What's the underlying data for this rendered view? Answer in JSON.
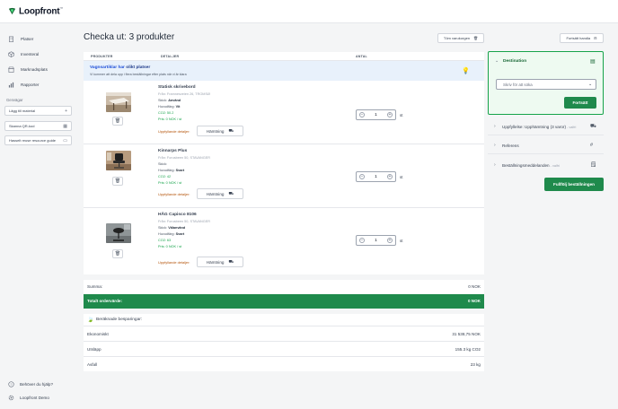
{
  "app": {
    "name": "Loopfront",
    "tm": "™"
  },
  "sidebar": {
    "items": [
      {
        "label": "Platser",
        "icon": "building-icon"
      },
      {
        "label": "Inventeral",
        "icon": "inventory-icon"
      },
      {
        "label": "Marknadsplats",
        "icon": "store-icon"
      },
      {
        "label": "Rapporter",
        "icon": "report-icon"
      }
    ],
    "section": "Genvägar",
    "shortcuts": [
      {
        "label": "Lägg till material",
        "glyph": "+"
      },
      {
        "label": "Skanna QR-kod",
        "glyph": "▦"
      },
      {
        "label": "Hasselt reuse resource guide",
        "glyph": "▭"
      }
    ],
    "help": "Behöver du hjälp?",
    "account": "Loopfront Demo"
  },
  "header": {
    "title": "Checka ut: 3 produkter",
    "clear_cart": "Töm varukorgen",
    "continue_shopping": "Fortsätt handla"
  },
  "cart": {
    "columns": {
      "products": "PRODUKTER",
      "details": "DETALJER",
      "quantity": "ANTAL"
    },
    "banner_prefix": "Vagnsartiklar har ",
    "banner_bold": "olikt platser",
    "banner_sub": "Vi kommer att dela upp i flera beställningar efter plats när vi är klara",
    "items": [
      {
        "name": "Statisk skrivebord",
        "from": "Från: Framnesveien 26, TROMSØ",
        "condition_label": "Skick: ",
        "condition": "Använd",
        "color_label": "Huvudfärg: ",
        "color": "Vit",
        "co2": "CO2: 50.2",
        "price": "Pris: 0 NOK / st",
        "detail_label": "Uppfyllande detaljer:",
        "pickup": "Hämtning",
        "qty": "1",
        "unit": "st"
      },
      {
        "name": "Kinnarps Plus",
        "from": "Från: Forusbeen 50, STAVANGER",
        "condition_label": "Skick: ",
        "condition": "",
        "color_label": "Huvudfärg: ",
        "color": "Svart",
        "co2": "CO2: 42",
        "price": "Pris: 0 NOK / st",
        "detail_label": "Uppfyllande detaljer:",
        "pickup": "Hämtning",
        "qty": "1",
        "unit": "st"
      },
      {
        "name": "HÅG Capisco 8106",
        "from": "Från: Forusbeen 50, STAVANGER",
        "condition_label": "Skick: ",
        "condition": "Välanvänd",
        "color_label": "Huvudfärg: ",
        "color": "Svart",
        "co2": "CO2: 63",
        "price": "Pris: 0 NOK / st",
        "detail_label": "Uppfyllande detaljer:",
        "pickup": "Hämtning",
        "qty": "1",
        "unit": "st"
      }
    ]
  },
  "totals": {
    "sum_label": "Summa:",
    "sum_value": "0 NOK",
    "order_label": "Totalt ordervärde:",
    "order_value": "0 NOK"
  },
  "savings": {
    "title": "Beräknade besparingar:",
    "rows": [
      {
        "label": "Ekonomiskt",
        "value": "31 538,75 NOK"
      },
      {
        "label": "Utsläpp",
        "value": "155.3 kg CO2"
      },
      {
        "label": "Avfall",
        "value": "23 kg"
      }
    ]
  },
  "checkout": {
    "destination_title": "Destination",
    "destination_placeholder": "Skriv för att söka",
    "continue": "Fortsätt",
    "fulfilment_label": "Uppfyllelse: Upphämtning (3 varor)",
    "fulfilment_opt": " - valfri",
    "reference_label": "Referens",
    "message_label": "Beställningsmeddelanden",
    "message_opt": " - valfri",
    "complete": "Fullfölj beställningen"
  },
  "colors": {
    "brand_green": "#1f8a4c",
    "banner_blue": "#e8f1fb",
    "warning": "#b45309"
  }
}
